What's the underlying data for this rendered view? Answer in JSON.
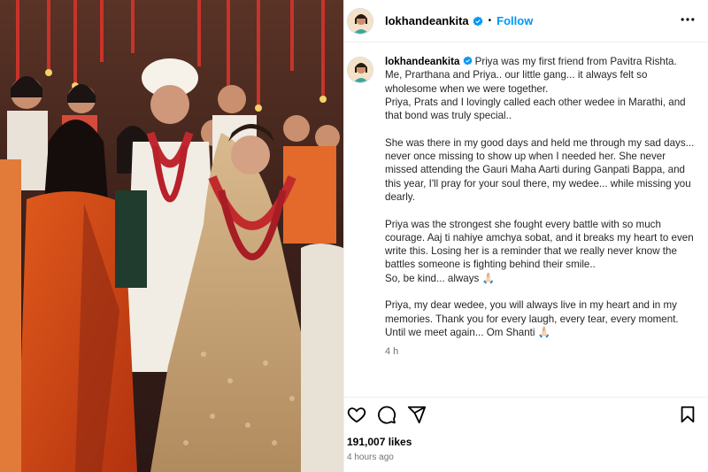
{
  "post": {
    "username": "lokhandeankita",
    "follow_label": "Follow",
    "separator": "•",
    "caption": "Priya was my first friend from Pavitra Rishta. Me, Prarthana and Priya.. our little gang... it always felt so wholesome when we were together.\nPriya, Prats and I lovingly called each other wedee in Marathi, and that bond was truly special..\n\nShe was there in my good days and held me through my sad days... never once missing to show up when I needed her. She never missed attending the Gauri Maha Aarti during Ganpati Bappa, and this year, I'll pray for your soul there, my wedee... while missing you dearly.\n\nPriya was the strongest she fought every battle with so much courage. Aaj ti nahiye amchya sobat, and it breaks my heart to even write this. Losing her is a reminder that we really never know the battles someone is fighting behind their smile..\nSo, be kind... always 🙏🏻\n\nPriya, my dear wedee, you will always live in my heart and in my memories. Thank you for every laugh, every tear, every moment. Until we meet again... Om Shanti 🙏🏻",
    "caption_time": "4 h",
    "likes": "191,007 likes",
    "posted_ago": "4 hours ago"
  },
  "icons": {
    "verified": "verified-badge-icon",
    "more": "more-options-icon",
    "like": "heart-icon",
    "comment": "comment-icon",
    "share": "share-icon",
    "save": "bookmark-icon"
  },
  "colors": {
    "accent": "#0095f6",
    "text": "#262626",
    "muted": "#737373",
    "border": "#efefef"
  }
}
